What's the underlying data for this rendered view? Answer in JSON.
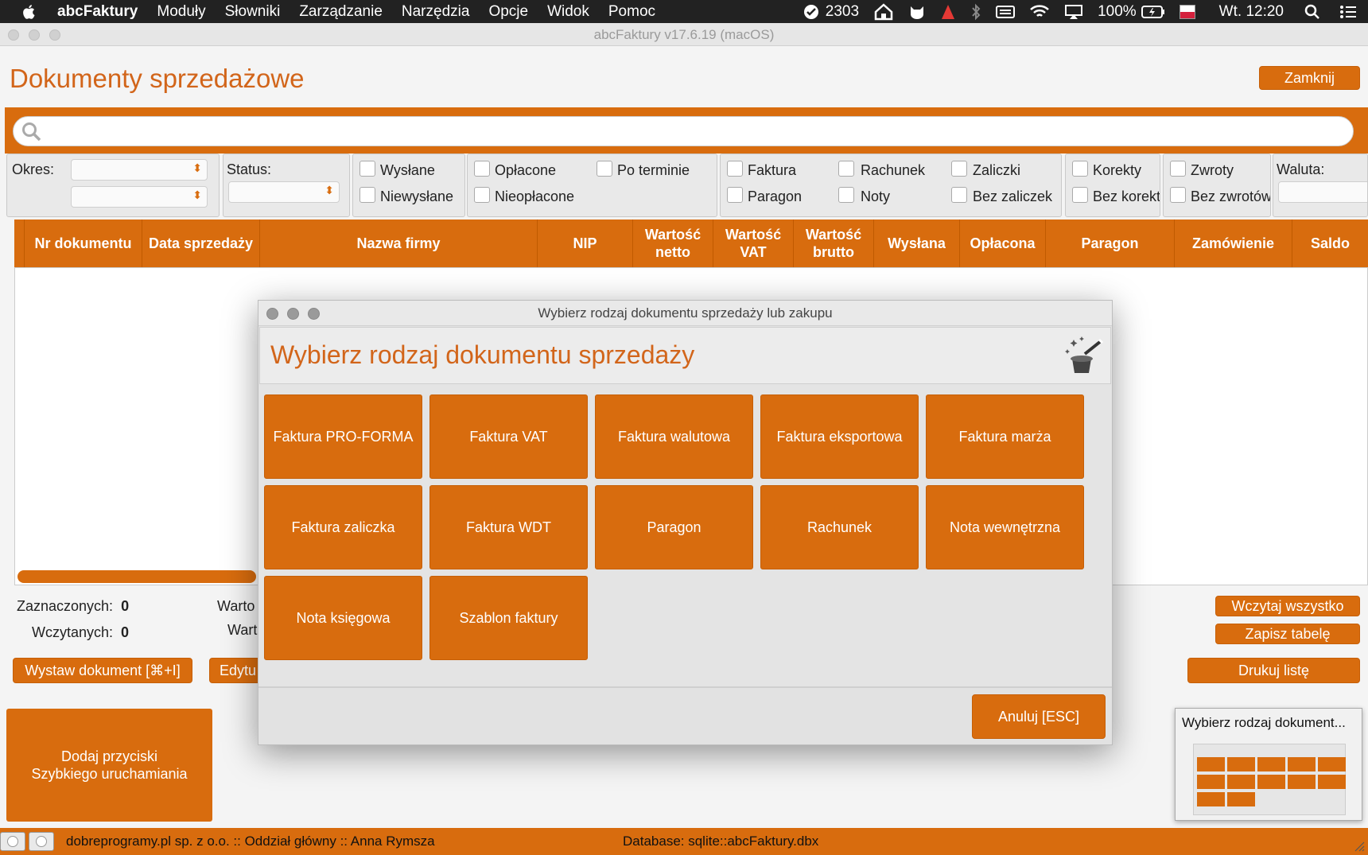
{
  "menubar": {
    "app_name": "abcFaktury",
    "items": [
      "Moduły",
      "Słowniki",
      "Zarządzanie",
      "Narzędzia",
      "Opcje",
      "Widok",
      "Pomoc"
    ],
    "counter": "2303",
    "battery": "100%",
    "clock": "Wt. 12:20"
  },
  "window": {
    "title": "abcFaktury v17.6.19 (macOS)"
  },
  "page": {
    "title": "Dokumenty sprzedażowe",
    "close_label": "Zamknij"
  },
  "filters": {
    "okres_label": "Okres:",
    "status_label": "Status:",
    "waluta_label": "Waluta:",
    "checkboxes": [
      "Wysłane",
      "Niewysłane",
      "Opłacone",
      "Po terminie",
      "Nieopłacone",
      "Faktura",
      "Rachunek",
      "Zaliczki",
      "Paragon",
      "Noty",
      "Bez zaliczek",
      "Korekty",
      "Bez korekt",
      "Zwroty",
      "Bez zwrotów"
    ]
  },
  "table": {
    "columns": [
      "Nr dokumentu",
      "Data sprzedaży",
      "Nazwa firmy",
      "NIP",
      "Wartość netto",
      "Wartość VAT",
      "Wartość brutto",
      "Wysłana",
      "Opłacona",
      "Paragon",
      "Zamówienie",
      "Saldo"
    ]
  },
  "footer": {
    "selected_label": "Zaznaczonych:",
    "selected_value": "0",
    "loaded_label": "Wczytanych:",
    "loaded_value": "0",
    "value_label_1": "Warto",
    "value_label_2": "Wart",
    "load_all": "Wczytaj wszystko",
    "save_table": "Zapisz tabelę",
    "issue_doc": "Wystaw dokument [⌘+I]",
    "edit": "Edytu",
    "print_list": "Drukuj listę"
  },
  "quick_launch": {
    "line1": "Dodaj przyciski",
    "line2": "Szybkiego uruchamiania"
  },
  "statusbar": {
    "company": "dobreprogramy.pl sp. z o.o. :: Oddział główny :: Anna Rymsza",
    "database": "Database: sqlite::abcFaktury.dbx"
  },
  "thumbnail": {
    "title": "Wybierz rodzaj dokument..."
  },
  "dialog": {
    "window_title": "Wybierz rodzaj dokumentu sprzedaży lub zakupu",
    "heading": "Wybierz rodzaj dokumentu sprzedaży",
    "tiles": [
      "Faktura PRO-FORMA",
      "Faktura VAT",
      "Faktura walutowa",
      "Faktura eksportowa",
      "Faktura marża",
      "Faktura zaliczka",
      "Faktura WDT",
      "Paragon",
      "Rachunek",
      "Nota wewnętrzna",
      "Nota księgowa",
      "Szablon faktury"
    ],
    "cancel": "Anuluj [ESC]"
  },
  "colors": {
    "accent": "#d86c0e",
    "title": "#d2651a"
  }
}
